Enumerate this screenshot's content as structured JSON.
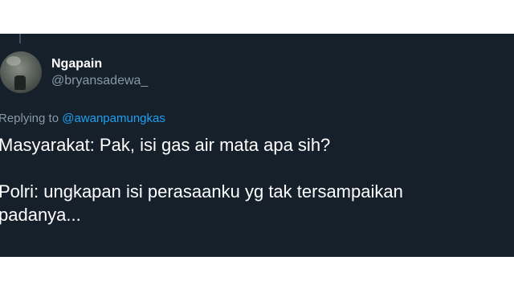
{
  "tweet": {
    "author": {
      "display_name": "Ngapain",
      "handle": "@bryansadewa_"
    },
    "reply_to": {
      "prefix": "Replying to ",
      "mention": "@awanpamungkas"
    },
    "text": {
      "line1": "Masyarakat: Pak, isi gas air mata apa sih?",
      "line2": "Polri: ungkapan isi perasaanku yg tak tersampaikan",
      "line3": "padanya..."
    }
  },
  "colors": {
    "tweet_background": "#15202b",
    "secondary_text": "#8899a6",
    "mention": "#1da1f2",
    "primary_text": "#ffffff"
  }
}
